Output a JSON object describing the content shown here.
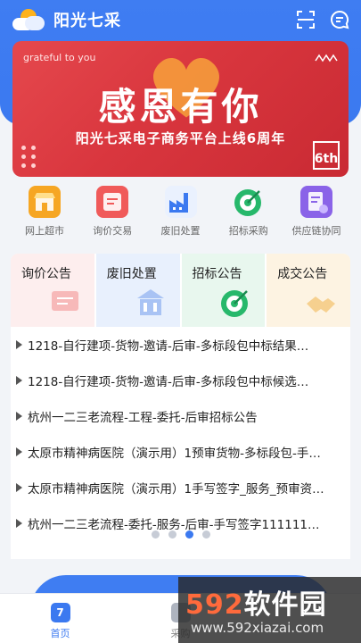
{
  "app": {
    "title": "阳光七采"
  },
  "topbar": {
    "scan_icon": "scan-icon",
    "message_icon": "chat-icon"
  },
  "banner": {
    "tagline": "grateful to you",
    "headline": "感恩有你",
    "subtitle": "阳光七采电子商务平台上线6周年",
    "badge": "6th"
  },
  "quick_nav": [
    {
      "label": "网上超市",
      "icon": "store-icon",
      "color": "#f6a623"
    },
    {
      "label": "询价交易",
      "icon": "inquiry-icon",
      "color": "#f05a5a"
    },
    {
      "label": "废旧处置",
      "icon": "factory-icon",
      "color": "#3b79f0"
    },
    {
      "label": "招标采购",
      "icon": "target-icon",
      "color": "#27b86b"
    },
    {
      "label": "供应链协同",
      "icon": "supply-chain-icon",
      "color": "#8a63e8"
    }
  ],
  "categories": [
    {
      "label": "询价公告",
      "bg": "#fdeeee"
    },
    {
      "label": "废旧处置",
      "bg": "#e8f0fd"
    },
    {
      "label": "招标公告",
      "bg": "#e8f7ee"
    },
    {
      "label": "成交公告",
      "bg": "#fdf3e2"
    }
  ],
  "notices": [
    "1218-自行建项-货物-邀请-后审-多标段包中标结果…",
    "1218-自行建项-货物-邀请-后审-多标段包中标候选…",
    "杭州一二三老流程-工程-委托-后审招标公告",
    "太原市精神病医院（演示用）1预审货物-多标段包-手…",
    "太原市精神病医院（演示用）1手写签字_服务_预审资…",
    "杭州一二三老流程-委托-服务-后审-手写签字111111…"
  ],
  "pager": {
    "count": 4,
    "active": 2
  },
  "tabbar": [
    {
      "label": "首页",
      "badge": "7"
    },
    {
      "label": "采购"
    }
  ],
  "watermark": {
    "brand_num": "592",
    "brand_text": "软件园",
    "url": "www.592xiazai.com"
  }
}
